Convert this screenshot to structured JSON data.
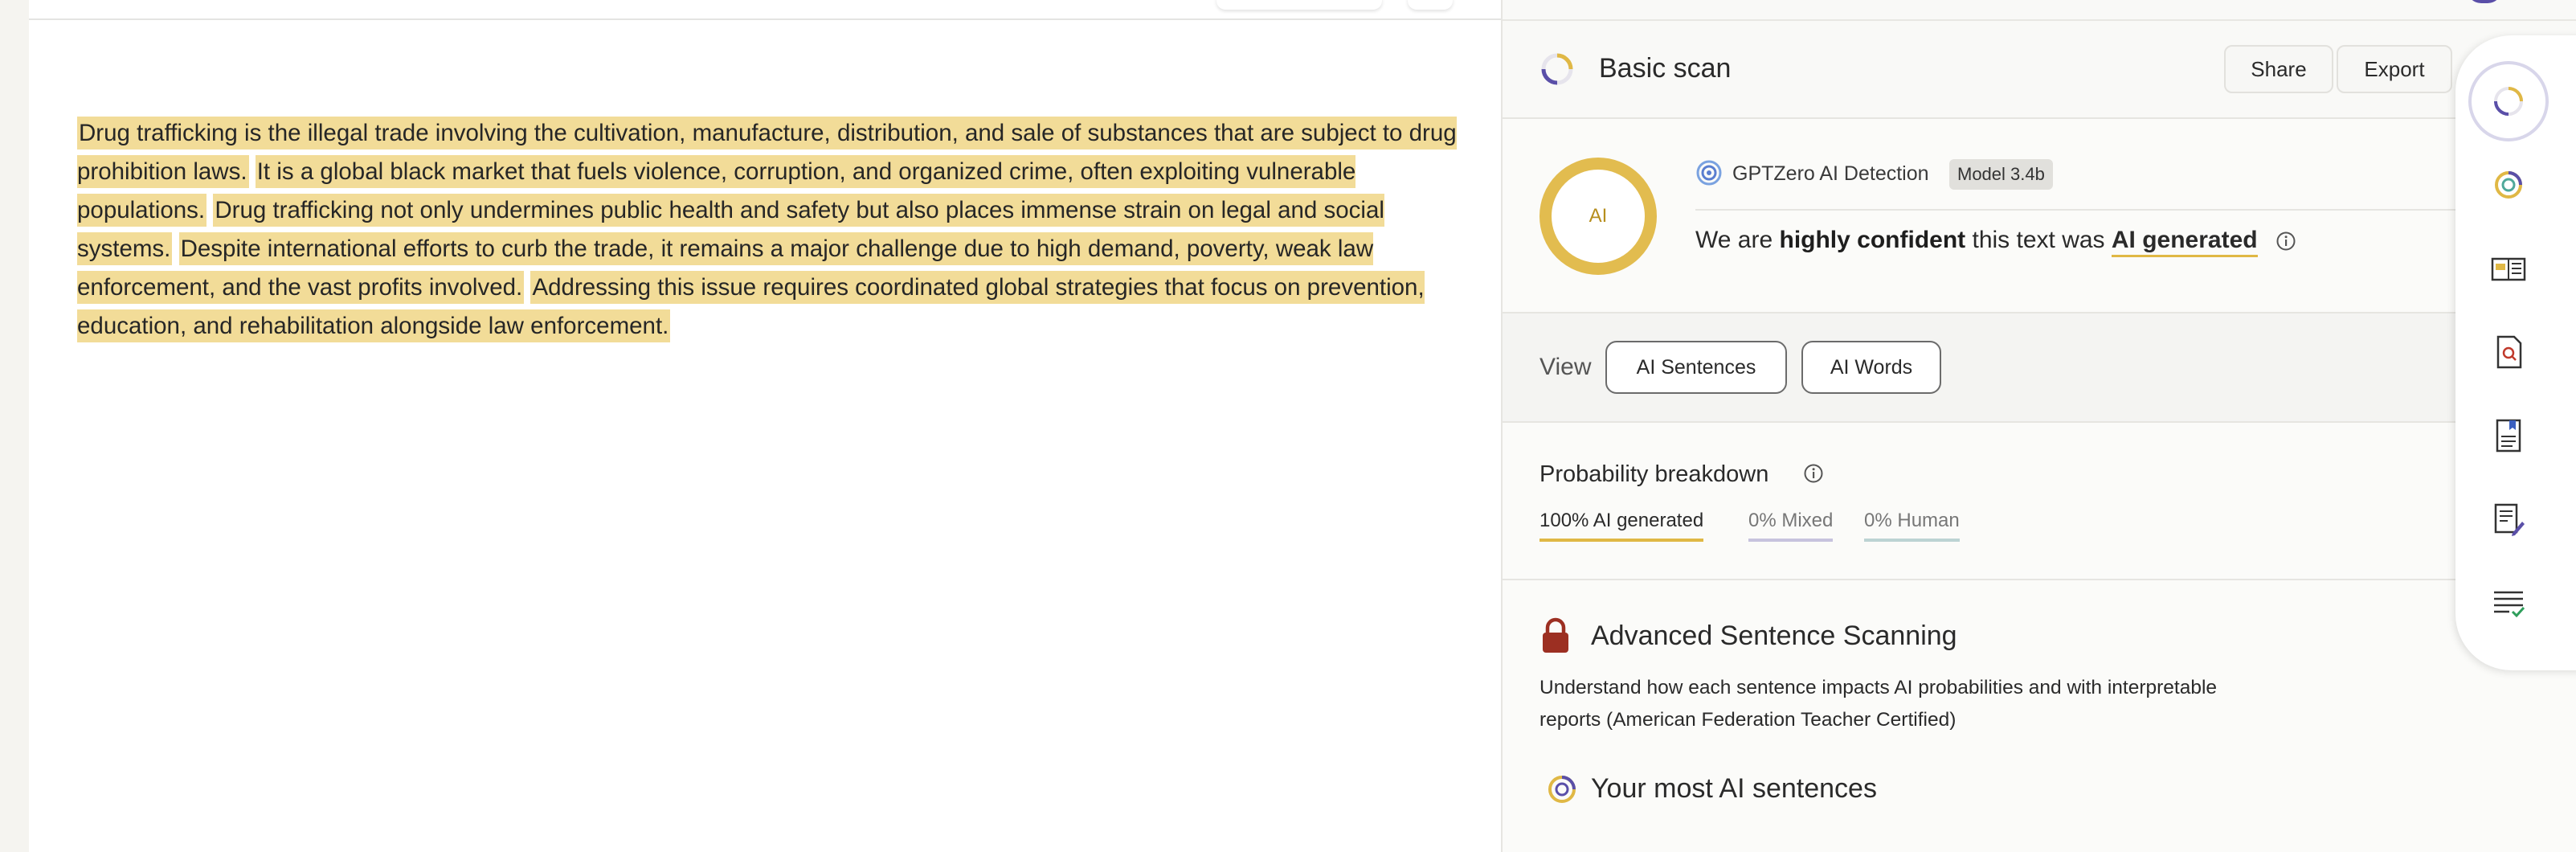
{
  "document": {
    "sentences": [
      "Drug trafficking is the illegal trade involving the cultivation, manufacture, distribution, and sale of substances that are subject to drug prohibition laws.",
      "It is a global black market that fuels violence, corruption, and organized crime, often exploiting vulnerable populations.",
      "Drug trafficking not only undermines public health and safety but also places immense strain on legal and social systems.",
      "Despite international efforts to curb the trade, it remains a major challenge due to high demand, poverty, weak law enforcement, and the vast profits involved.",
      "Addressing this issue requires coordinated global strategies that focus on prevention, education, and rehabilitation alongside law enforcement."
    ]
  },
  "header": {
    "title": "Basic scan",
    "share_label": "Share",
    "export_label": "Export"
  },
  "verdict": {
    "ring_label": "AI",
    "detector_name": "GPTZero AI Detection",
    "model_badge": "Model 3.4b",
    "prefix": "We are ",
    "confidence": "highly confident",
    "middle": " this text was ",
    "result": "AI generated"
  },
  "view": {
    "label": "View",
    "buttons": [
      "AI Sentences",
      "AI Words"
    ]
  },
  "probability": {
    "title": "Probability breakdown",
    "ai": "100% AI generated",
    "mixed": "0% Mixed",
    "human": "0% Human"
  },
  "advanced": {
    "title": "Advanced Sentence Scanning",
    "description": "Understand how each sentence impacts AI probabilities and with interpretable reports (American Federation Teacher Certified)",
    "most_title": "Your most AI sentences"
  },
  "colors": {
    "ai": "#e0b845",
    "mixed": "#c7c3de",
    "human": "#bcd3d3",
    "highlight": "#f2dc98",
    "lock": "#9c2f22",
    "brand": "#5a4fa8"
  }
}
